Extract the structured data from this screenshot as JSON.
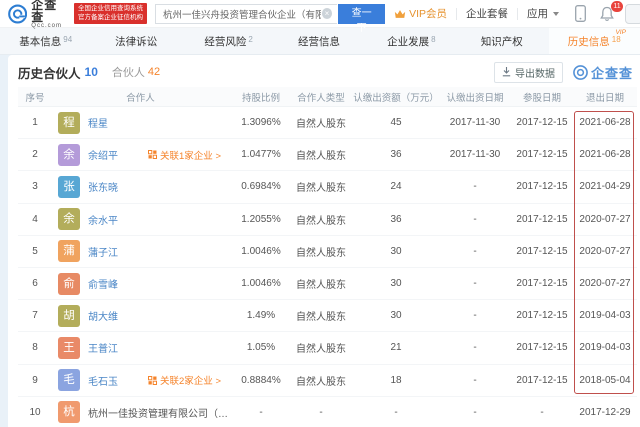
{
  "brand": {
    "name": "企查查",
    "domain": "Qcc.com",
    "badge_line1": "全国企业信用查询系统",
    "badge_line2": "官方备案企业征信机构"
  },
  "search": {
    "value": "杭州一佳兴舟投资管理合伙企业（有限合伙）",
    "button": "查一下"
  },
  "header_menu": {
    "vip": "VIP会员",
    "package": "企业套餐",
    "apps": "应用",
    "bell_badge": "11"
  },
  "tabs": [
    {
      "label": "基本信息",
      "count": "94"
    },
    {
      "label": "法律诉讼",
      "count": ""
    },
    {
      "label": "经营风险",
      "count": "2"
    },
    {
      "label": "经营信息",
      "count": ""
    },
    {
      "label": "企业发展",
      "count": "8"
    },
    {
      "label": "知识产权",
      "count": ""
    },
    {
      "label": "历史信息",
      "count": "18",
      "vip_tag": "VIP"
    }
  ],
  "section": {
    "title": "历史合伙人",
    "title_count": "10",
    "secondary": "合伙人",
    "secondary_count": "42",
    "export_label": "导出数据",
    "watermark": "企查查"
  },
  "table": {
    "headers": [
      "序号",
      "合作人",
      "持股比例",
      "合作人类型",
      "认缴出资额（万元）",
      "认缴出资日期",
      "参股日期",
      "退出日期"
    ],
    "rows": [
      {
        "no": "1",
        "avatar": "程",
        "avatar_color": "#b3ad5b",
        "name": "程星",
        "tag": "",
        "ratio": "1.3096%",
        "type": "自然人股东",
        "amount": "45",
        "sub_date": "2017-11-30",
        "join_date": "2017-12-15",
        "exit_date": "2021-06-28"
      },
      {
        "no": "2",
        "avatar": "余",
        "avatar_color": "#b49bd9",
        "name": "余绍平",
        "tag": "关联1家企业 >",
        "ratio": "1.0477%",
        "type": "自然人股东",
        "amount": "36",
        "sub_date": "2017-11-30",
        "join_date": "2017-12-15",
        "exit_date": "2021-06-28"
      },
      {
        "no": "3",
        "avatar": "张",
        "avatar_color": "#58a7d4",
        "name": "张东晓",
        "tag": "",
        "ratio": "0.6984%",
        "type": "自然人股东",
        "amount": "24",
        "sub_date": "-",
        "join_date": "2017-12-15",
        "exit_date": "2021-04-29"
      },
      {
        "no": "4",
        "avatar": "余",
        "avatar_color": "#b3ad5b",
        "name": "余水平",
        "tag": "",
        "ratio": "1.2055%",
        "type": "自然人股东",
        "amount": "36",
        "sub_date": "-",
        "join_date": "2017-12-15",
        "exit_date": "2020-07-27"
      },
      {
        "no": "5",
        "avatar": "蒲",
        "avatar_color": "#f0a35f",
        "name": "蒲子江",
        "tag": "",
        "ratio": "1.0046%",
        "type": "自然人股东",
        "amount": "30",
        "sub_date": "-",
        "join_date": "2017-12-15",
        "exit_date": "2020-07-27"
      },
      {
        "no": "6",
        "avatar": "俞",
        "avatar_color": "#e78a64",
        "name": "俞雪峰",
        "tag": "",
        "ratio": "1.0046%",
        "type": "自然人股东",
        "amount": "30",
        "sub_date": "-",
        "join_date": "2017-12-15",
        "exit_date": "2020-07-27"
      },
      {
        "no": "7",
        "avatar": "胡",
        "avatar_color": "#b3ad5b",
        "name": "胡大维",
        "tag": "",
        "ratio": "1.49%",
        "type": "自然人股东",
        "amount": "30",
        "sub_date": "-",
        "join_date": "2017-12-15",
        "exit_date": "2019-04-03"
      },
      {
        "no": "8",
        "avatar": "王",
        "avatar_color": "#e98a68",
        "name": "王普江",
        "tag": "",
        "ratio": "1.05%",
        "type": "自然人股东",
        "amount": "21",
        "sub_date": "-",
        "join_date": "2017-12-15",
        "exit_date": "2019-04-03"
      },
      {
        "no": "9",
        "avatar": "毛",
        "avatar_color": "#8ba4e0",
        "name": "毛石玉",
        "tag": "关联2家企业 >",
        "ratio": "0.8884%",
        "type": "自然人股东",
        "amount": "18",
        "sub_date": "-",
        "join_date": "2017-12-15",
        "exit_date": "2018-05-04"
      },
      {
        "no": "10",
        "avatar": "杭",
        "avatar_color": "#f09a6e",
        "name": "杭州一佳投资管理有限公司（执行事务合伙人）",
        "link": false,
        "tag": "",
        "ratio": "-",
        "type": "-",
        "amount": "-",
        "sub_date": "-",
        "join_date": "-",
        "exit_date": "2017-12-29"
      }
    ]
  },
  "colors": {
    "accent_blue": "#3a7edb",
    "brand_orange": "#f5842c",
    "gov_badge_red": "#d9302c",
    "exit_highlight_border": "#bf4f4c",
    "link_blue": "#4a86c6"
  }
}
